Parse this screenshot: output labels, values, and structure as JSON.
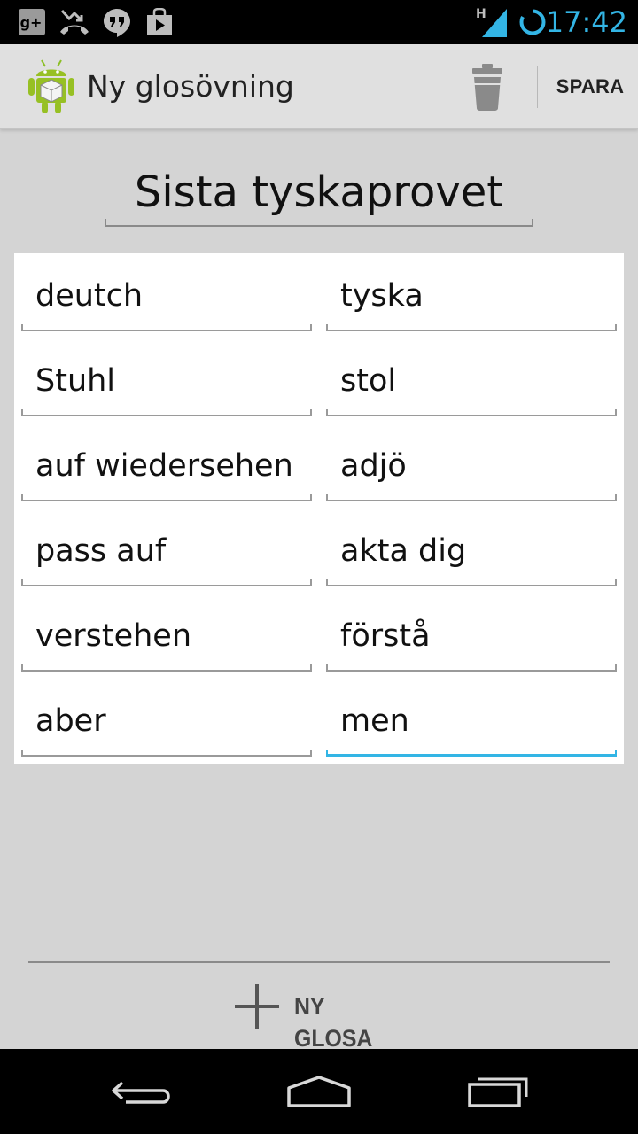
{
  "status_bar": {
    "time": "17:42",
    "network_label": "H",
    "icons": [
      "google-plus-icon",
      "missed-call-icon",
      "hangouts-icon",
      "play-store-icon",
      "signal-icon",
      "sync-icon"
    ]
  },
  "action_bar": {
    "title": "Ny glosövning",
    "save_label": "SPARA",
    "icons": [
      "android-app-icon",
      "trash-icon"
    ]
  },
  "exercise": {
    "title": "Sista tyskaprovet"
  },
  "words": [
    {
      "foreign": "deutch",
      "native": "tyska"
    },
    {
      "foreign": "Stuhl",
      "native": "stol"
    },
    {
      "foreign": "auf wiedersehen",
      "native": "adjö"
    },
    {
      "foreign": "pass auf",
      "native": "akta dig"
    },
    {
      "foreign": "verstehen",
      "native": "förstå"
    },
    {
      "foreign": "aber",
      "native": "men"
    }
  ],
  "focused_field": "men",
  "add_button": {
    "label": "NY GLOSA",
    "icon": "plus-icon"
  },
  "nav_bar": {
    "icons": [
      "back-icon",
      "home-icon",
      "recent-apps-icon"
    ]
  },
  "colors": {
    "accent": "#33b5e5",
    "background": "#d4d4d4",
    "action_bar": "#e0e0e0",
    "card": "#ffffff"
  }
}
